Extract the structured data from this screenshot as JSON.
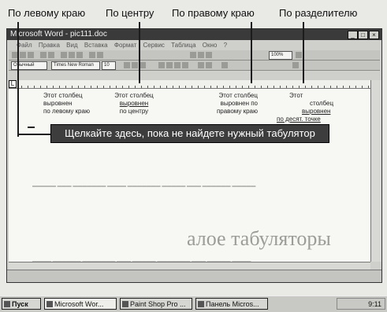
{
  "captions": {
    "left": "По левому краю",
    "center": "По центру",
    "right": "По правому краю",
    "decimal": "По разделителю"
  },
  "window": {
    "title": "Microsoft Word - pic111.doc",
    "menu": [
      "Файл",
      "Правка",
      "Вид",
      "Вставка",
      "Формат",
      "Сервис",
      "Таблица",
      "Окно",
      "?"
    ],
    "zoom": "100%",
    "style": "Обычный",
    "font": "Times New Roman",
    "size": "10"
  },
  "document": {
    "columns": {
      "left": [
        "Этот столбец",
        "выровнен",
        "по левому краю"
      ],
      "center": [
        "Этот столбец",
        "выровнен",
        "по центру"
      ],
      "right": [
        "Этот столбец",
        "выровнен по",
        "правому краю"
      ],
      "decimal": [
        "Этот",
        "столбец",
        "выровнен",
        "по десят. точке"
      ]
    },
    "callout": "Щелкайте здесь, пока не найдете нужный табулятор",
    "heading_fragment": "алое табуляторы"
  },
  "taskbar": {
    "start": "Пуск",
    "tasks": [
      "Microsoft Wor...",
      "Paint Shop Pro ...",
      "Панель Micros..."
    ],
    "clock": "9:11"
  }
}
